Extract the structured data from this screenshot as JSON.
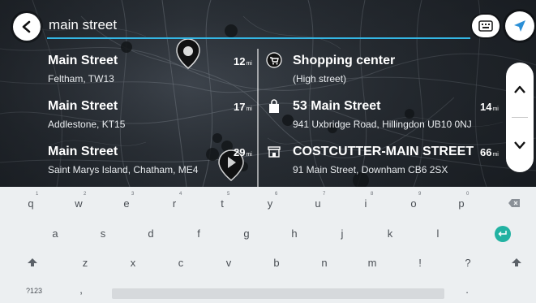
{
  "search": {
    "query": "main street"
  },
  "icons": {
    "back": "arrow-left-icon",
    "keyboard_toggle": "keyboard-icon",
    "navigate": "navigation-arrow-icon",
    "scroll_up": "chevron-up-icon",
    "scroll_down": "chevron-down-icon",
    "shopping": "shopping-cart-icon",
    "shop": "shopping-bag-icon",
    "supermarket": "shop-front-icon"
  },
  "results_left": [
    {
      "title": "Main Street",
      "subtitle": "Feltham, TW13",
      "distance": "12",
      "unit": "mi"
    },
    {
      "title": "Main Street",
      "subtitle": "Addlestone, KT15",
      "distance": "17",
      "unit": "mi"
    },
    {
      "title": "Main Street",
      "subtitle": "Saint Marys Island, Chatham, ME4",
      "distance": "29",
      "unit": "mi"
    }
  ],
  "results_right": [
    {
      "title": "Shopping center",
      "subtitle": "(High street)",
      "distance": "",
      "unit": ""
    },
    {
      "title": "53 Main Street",
      "subtitle": "941 Uxbridge Road, Hillingdon UB10 0NJ",
      "distance": "14",
      "unit": "mi"
    },
    {
      "title": "COSTCUTTER-MAIN STREET",
      "subtitle": "91 Main Street, Downham CB6 2SX",
      "distance": "66",
      "unit": "mi"
    }
  ],
  "keyboard": {
    "row1": [
      {
        "key": "q",
        "hint": "1"
      },
      {
        "key": "w",
        "hint": "2"
      },
      {
        "key": "e",
        "hint": "3"
      },
      {
        "key": "r",
        "hint": "4"
      },
      {
        "key": "t",
        "hint": "5"
      },
      {
        "key": "y",
        "hint": "6"
      },
      {
        "key": "u",
        "hint": "7"
      },
      {
        "key": "i",
        "hint": "8"
      },
      {
        "key": "o",
        "hint": "9"
      },
      {
        "key": "p",
        "hint": "0"
      }
    ],
    "row2": [
      "a",
      "s",
      "d",
      "f",
      "g",
      "h",
      "j",
      "k",
      "l"
    ],
    "row3": [
      "z",
      "x",
      "c",
      "v",
      "b",
      "n",
      "m",
      "!",
      "?"
    ],
    "numbers_label": "?123",
    "comma": ",",
    "period": ".",
    "backspace_icon": "backspace-icon",
    "enter_icon": "enter-icon",
    "shift_icon": "shift-icon"
  },
  "colors": {
    "accent": "#34b6e4",
    "enter_key": "#22b2a2",
    "text_dark": "#1b1f24"
  }
}
